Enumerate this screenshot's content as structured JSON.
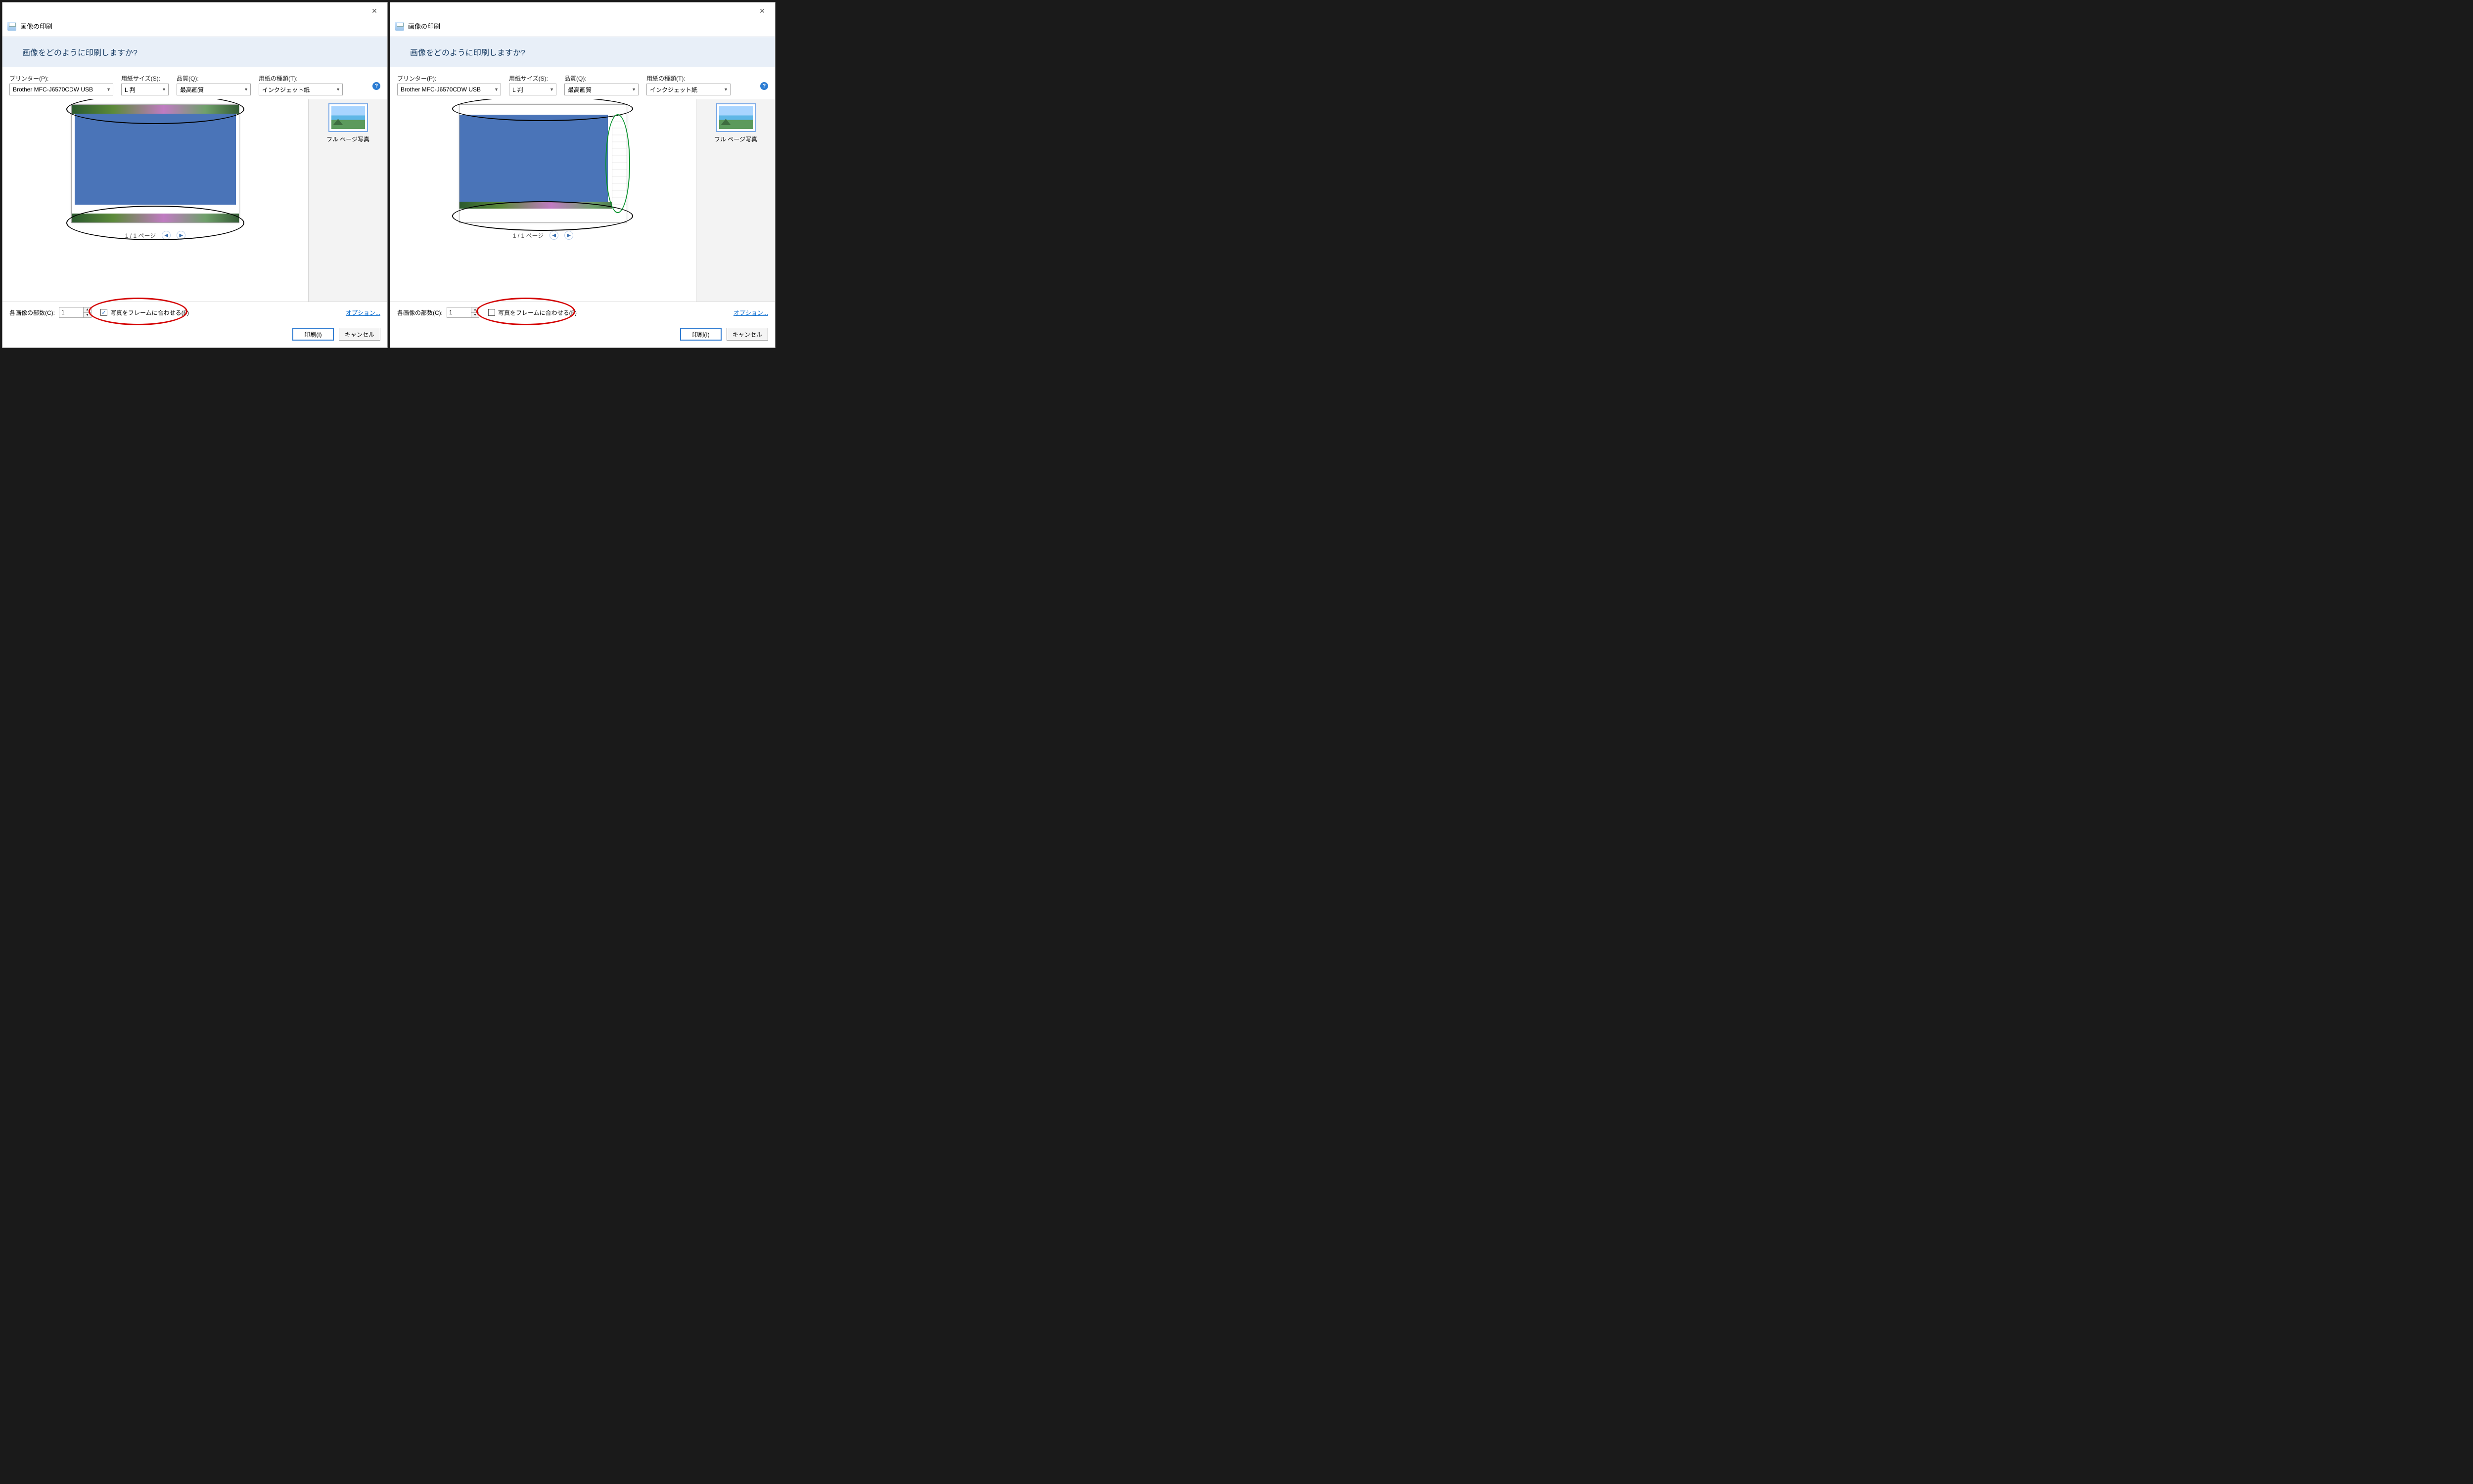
{
  "left": {
    "page_title": "画像の印刷",
    "question": "画像をどのように印刷しますか?",
    "printer": {
      "label": "プリンター(P):",
      "value": "Brother MFC-J6570CDW USB"
    },
    "paper_size": {
      "label": "用紙サイズ(S):",
      "value": "L 判"
    },
    "quality": {
      "label": "品質(Q):",
      "value": "最高画質"
    },
    "paper_type": {
      "label": "用紙の種類(T):",
      "value": "インクジェット紙"
    },
    "pager_text": "1 / 1 ページ",
    "copies_label": "各画像の部数(C):",
    "copies_value": "1",
    "fit_checked": true,
    "fit_label": "写真をフレームに合わせる(F)",
    "options_link": "オプション...",
    "thumb_label": "フル ページ写真",
    "print_btn": "印刷(I)",
    "cancel_btn": "キャンセル"
  },
  "right": {
    "page_title": "画像の印刷",
    "question": "画像をどのように印刷しますか?",
    "printer": {
      "label": "プリンター(P):",
      "value": "Brother MFC-J6570CDW USB"
    },
    "paper_size": {
      "label": "用紙サイズ(S):",
      "value": "L 判"
    },
    "quality": {
      "label": "品質(Q):",
      "value": "最高画質"
    },
    "paper_type": {
      "label": "用紙の種類(T):",
      "value": "インクジェット紙"
    },
    "pager_text": "1 / 1 ページ",
    "copies_label": "各画像の部数(C):",
    "copies_value": "1",
    "fit_checked": false,
    "fit_label": "写真をフレームに合わせる(F)",
    "options_link": "オプション...",
    "thumb_label": "フル ページ写真",
    "print_btn": "印刷(I)",
    "cancel_btn": "キャンセル"
  }
}
